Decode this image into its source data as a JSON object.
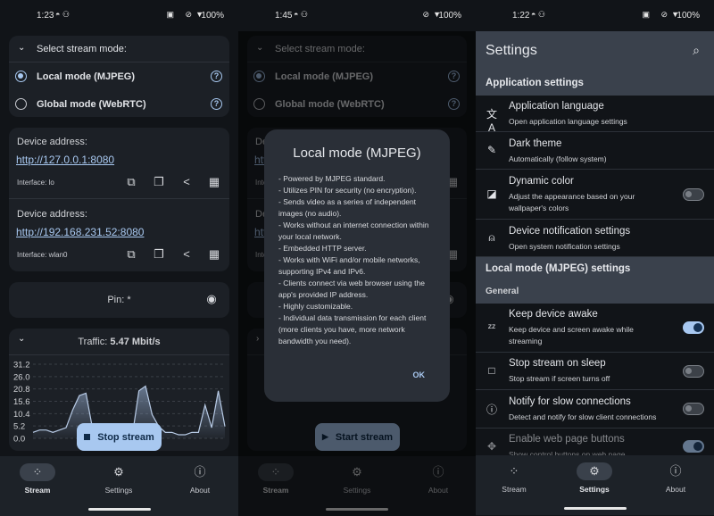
{
  "screen1": {
    "status": {
      "time": "1:23",
      "battery": "100%"
    },
    "mode_card": {
      "title": "Select stream mode:",
      "options": [
        {
          "label": "Local mode (MJPEG)",
          "selected": true
        },
        {
          "label": "Global mode (WebRTC)",
          "selected": false
        }
      ]
    },
    "addresses": [
      {
        "label": "Device address:",
        "url": "http://127.0.0.1:8080",
        "interface": "Interface: lo"
      },
      {
        "label": "Device address:",
        "url": "http://192.168.231.52:8080",
        "interface": "Interface: wlan0"
      }
    ],
    "pin": {
      "label": "Pin: *"
    },
    "traffic": {
      "label": "Traffic: ",
      "value": "5.47 Mbit/s"
    },
    "stop_button": "Stop stream",
    "start_button": "Start stream"
  },
  "nav": {
    "items": [
      {
        "label": "Stream",
        "icon": "stream-icon"
      },
      {
        "label": "Settings",
        "icon": "gear-icon"
      },
      {
        "label": "About",
        "icon": "info-icon"
      }
    ]
  },
  "screen2": {
    "status": {
      "time": "1:45",
      "battery": "100%"
    },
    "dialog": {
      "title": "Local mode (MJPEG)",
      "body": "- Powered by MJPEG standard.\n - Utilizes PIN for security (no encryption).\n - Sends video as a series of independent images (no audio).\n - Works without an internet connection within your local network.\n - Embedded HTTP server.\n - Works with WiFi and/or mobile networks, supporting IPv4 and IPv6.\n - Clients connect via web browser using the app's provided IP address.\n - Highly customizable.\n - Individual data transmission for each client (more clients you have, more network bandwidth you need).",
      "ok": "OK"
    }
  },
  "screen3": {
    "status": {
      "time": "1:22",
      "battery": "100%"
    },
    "title": "Settings",
    "section1": "Application settings",
    "items1": [
      {
        "title": "Application language",
        "subtitle": "Open application language settings",
        "icon": "translate-icon"
      },
      {
        "title": "Dark theme",
        "subtitle": "Automatically (follow system)",
        "icon": "theme-icon"
      },
      {
        "title": "Dynamic color",
        "subtitle": "Adjust the appearance based on your wallpaper's colors",
        "icon": "palette-icon",
        "toggle": false
      },
      {
        "title": "Device notification settings",
        "subtitle": "Open system notification settings",
        "icon": "bell-icon"
      }
    ],
    "section2": "Local mode (MJPEG) settings",
    "subsection": "General",
    "items2": [
      {
        "title": "Keep device awake",
        "subtitle": "Keep device and screen awake while streaming",
        "icon": "sleep-icon",
        "toggle": true
      },
      {
        "title": "Stop stream on sleep",
        "subtitle": "Stop stream if screen turns off",
        "icon": "stop-icon",
        "toggle": false
      },
      {
        "title": "Notify for slow connections",
        "subtitle": "Detect and notify for slow client connections",
        "icon": "alert-icon",
        "toggle": false
      },
      {
        "title": "Enable web page buttons",
        "subtitle": "Show control buttons on web page",
        "icon": "dpad-icon",
        "toggle": true
      }
    ]
  },
  "accent": "#a8c8f0",
  "chart_data": {
    "type": "area",
    "yticks": [
      "31.2",
      "26.0",
      "20.8",
      "15.6",
      "10.4",
      "5.2",
      "0.0"
    ],
    "ylim": [
      0,
      31.2
    ],
    "grid": true,
    "values": [
      2.5,
      3.5,
      3.5,
      2.5,
      3.5,
      4.5,
      12,
      18,
      19,
      4,
      2,
      1,
      0.5,
      0.5,
      0.5,
      1,
      20,
      22,
      10,
      5,
      2.5,
      2.5,
      1.5,
      1.5,
      2.5,
      2.5,
      14,
      4.5,
      20,
      5
    ]
  }
}
